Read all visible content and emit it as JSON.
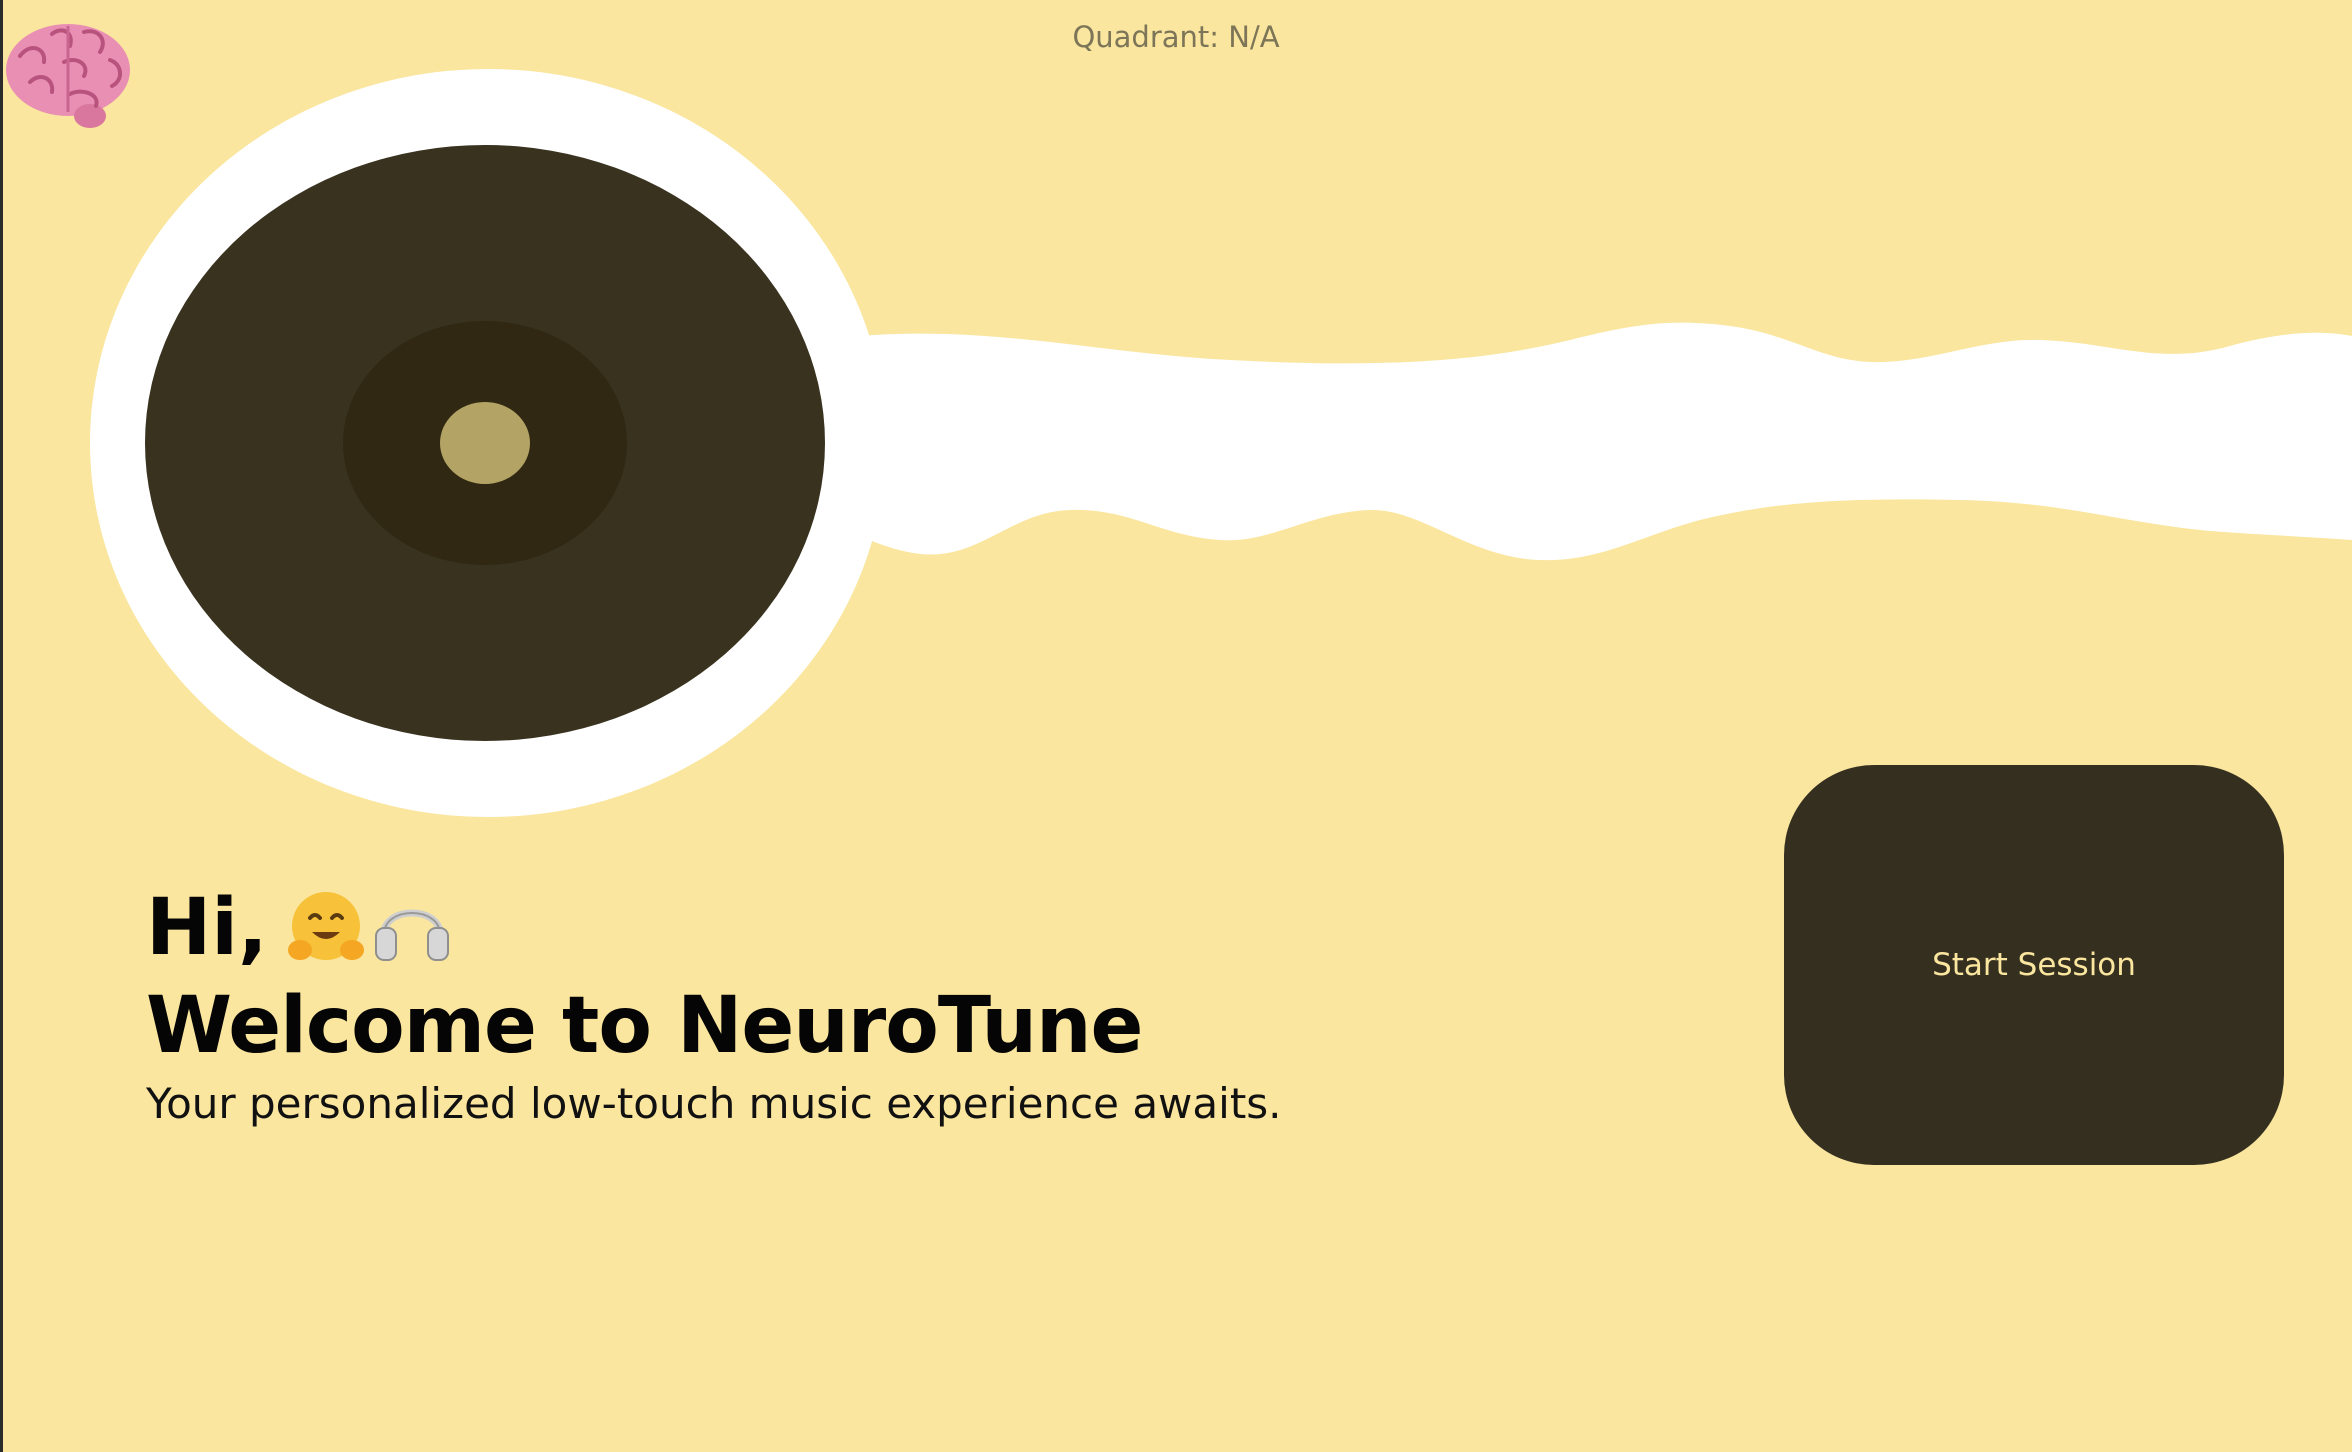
{
  "app": {
    "status_text": "Quadrant: N/A",
    "logo_icon": "brain-icon"
  },
  "hero": {
    "greeting": "Hi,",
    "greeting_icons": [
      "hugging-face-icon",
      "headphones-icon"
    ],
    "title": "Welcome to NeuroTune",
    "subtitle": "Your personalized low-touch music experience awaits."
  },
  "actions": {
    "start_label": "Start Session"
  },
  "colors": {
    "background": "#fae69e",
    "record_outer": "#38321f",
    "record_label": "#302812",
    "record_center": "#b3a465",
    "button": "#352f20",
    "button_text": "#fae69e",
    "wave": "#ffffff"
  }
}
